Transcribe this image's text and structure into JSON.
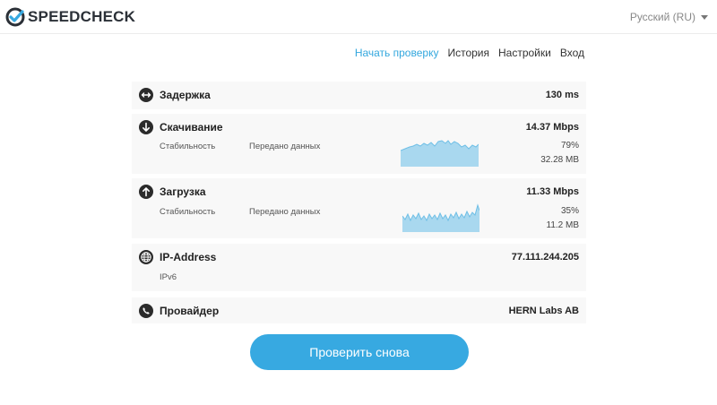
{
  "app": {
    "name": "SPEEDCHECK",
    "language": "Русский (RU)"
  },
  "nav": {
    "items": [
      "Начать проверку",
      "История",
      "Настройки",
      "Вход"
    ],
    "active_index": 0
  },
  "colors": {
    "accent": "#37a9e1",
    "nav_active": "#33a7de",
    "graph_fill": "#a9d8ef",
    "graph_stroke": "#6fbfe6",
    "row_bg": "#f8f8f8"
  },
  "results": {
    "latency": {
      "label": "Задержка",
      "value": "130 ms",
      "icon": "arrows-horizontal-icon"
    },
    "download": {
      "label": "Скачивание",
      "value": "14.37 Mbps",
      "icon": "arrow-down-icon",
      "stability_label": "Стабильность",
      "transferred_label": "Передано данных",
      "stability": "79%",
      "transferred": "32.28 MB"
    },
    "upload": {
      "label": "Загрузка",
      "value": "11.33 Mbps",
      "icon": "arrow-up-icon",
      "stability_label": "Стабильность",
      "transferred_label": "Передано данных",
      "stability": "35%",
      "transferred": "11.2 MB"
    },
    "ip": {
      "label": "IP-Address",
      "value": "77.111.244.205",
      "version": "IPv6",
      "icon": "globe-icon"
    },
    "provider": {
      "label": "Провайдер",
      "value": "HERN Labs AB",
      "icon": "phone-icon"
    }
  },
  "actions": {
    "retest_label": "Проверить снова"
  }
}
